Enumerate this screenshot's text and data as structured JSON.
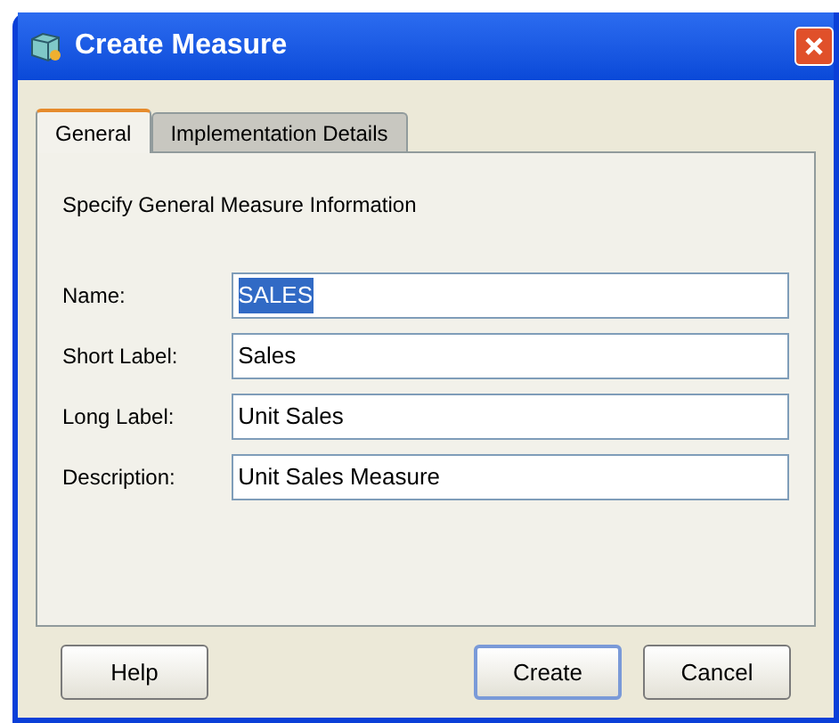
{
  "window": {
    "title": "Create Measure"
  },
  "tabs": [
    {
      "label": "General",
      "selected": true
    },
    {
      "label": "Implementation Details",
      "selected": false
    }
  ],
  "panel": {
    "heading": "Specify General Measure Information",
    "fields": [
      {
        "label": "Name:",
        "value": "SALES",
        "selected": true
      },
      {
        "label": "Short Label:",
        "value": "Sales",
        "selected": false
      },
      {
        "label": "Long Label:",
        "value": "Unit Sales",
        "selected": false
      },
      {
        "label": "Description:",
        "value": "Unit Sales Measure",
        "selected": false
      }
    ]
  },
  "left_buttons": [
    {
      "label": "Help",
      "default": false
    }
  ],
  "right_buttons": [
    {
      "label": "Create",
      "default": true
    },
    {
      "label": "Cancel",
      "default": false
    }
  ]
}
